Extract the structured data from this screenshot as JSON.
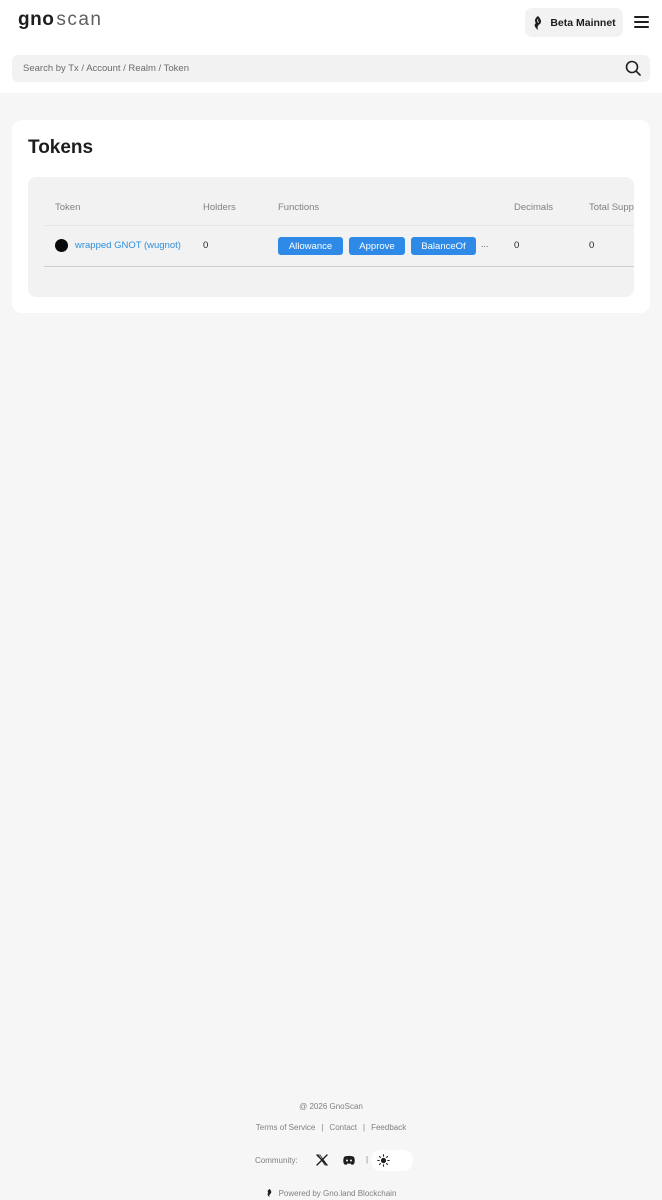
{
  "header": {
    "logo": {
      "part1": "gno",
      "part2": "scan"
    },
    "network_label": "Beta Mainnet",
    "menu_icon": "hamburger-icon"
  },
  "search": {
    "placeholder": "Search by Tx / Account / Realm / Token",
    "icon": "search-icon"
  },
  "main": {
    "title": "Tokens",
    "table": {
      "columns": [
        "Token",
        "Holders",
        "Functions",
        "Decimals",
        "Total Supp"
      ],
      "rows": [
        {
          "token": "wrapped GNOT (wugnot)",
          "holders": "0",
          "functions": [
            "Allowance",
            "Approve",
            "BalanceOf"
          ],
          "more": "...",
          "decimals": "0",
          "total_supply": "0"
        }
      ]
    }
  },
  "footer": {
    "copyright": "@ 2026 GnoScan",
    "links": [
      "Terms of Service",
      "Contact",
      "Feedback"
    ],
    "separator": "|",
    "community_label": "Community:",
    "social_icons": [
      "x-icon",
      "discord-icon"
    ],
    "theme_icon": "sun-icon",
    "powered_by": "Powered by Gno.land Blockchain"
  },
  "colors": {
    "accent": "#2e8ae6",
    "link": "#2f8fd9",
    "background": "#f6f6f6",
    "card": "#ffffff"
  }
}
